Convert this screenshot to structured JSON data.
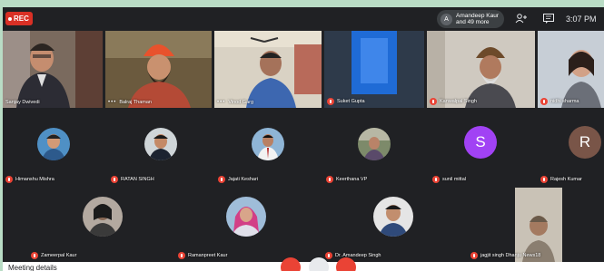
{
  "recording": {
    "label": "REC"
  },
  "host": {
    "avatar_letter": "A",
    "line1": "Amandeep Kaur",
    "line2": "and 49 more"
  },
  "clock": "3:07 PM",
  "icons": {
    "people": "people-add-icon",
    "chat": "chat-icon",
    "mute": "mic-off-icon",
    "more": "more-options-icon"
  },
  "colors": {
    "mute_red": "#ea4335",
    "rec_red": "#d93025",
    "tile_bg": "#3c4043",
    "avatar_purple": "#a142f4",
    "avatar_brown": "#795548"
  },
  "participants_row1": [
    {
      "name": "Sanjay Dwivedi",
      "muted": false
    },
    {
      "name": "Balraj Thaman",
      "muted": false
    },
    {
      "name": "Vinod Garg",
      "muted": false
    },
    {
      "name": "Suket Gupta",
      "muted": true
    },
    {
      "name": "Kanwalpal Singh",
      "muted": true
    },
    {
      "name": "nidhi sharma",
      "muted": true
    }
  ],
  "participants_row2": [
    {
      "name": "Himanshu Mishra",
      "muted": true
    },
    {
      "name": "RATAN SINGH",
      "muted": true
    },
    {
      "name": "Jajati Keshari",
      "muted": true
    },
    {
      "name": "Keerthana VP",
      "muted": true
    },
    {
      "name": "sunil mittal",
      "muted": true,
      "letter": "S"
    },
    {
      "name": "Rajesh Kumar",
      "muted": true,
      "letter": "R"
    }
  ],
  "participants_row3": [
    {
      "name": "Zameerpal Kaur",
      "muted": true
    },
    {
      "name": "Ramanpreet Kaur",
      "muted": true
    },
    {
      "name": "Dr. Amandeep Singh",
      "muted": true
    },
    {
      "name": "jagjit singh Dhanju News18",
      "muted": true
    }
  ],
  "footer": {
    "meeting_details": "Meeting details"
  }
}
